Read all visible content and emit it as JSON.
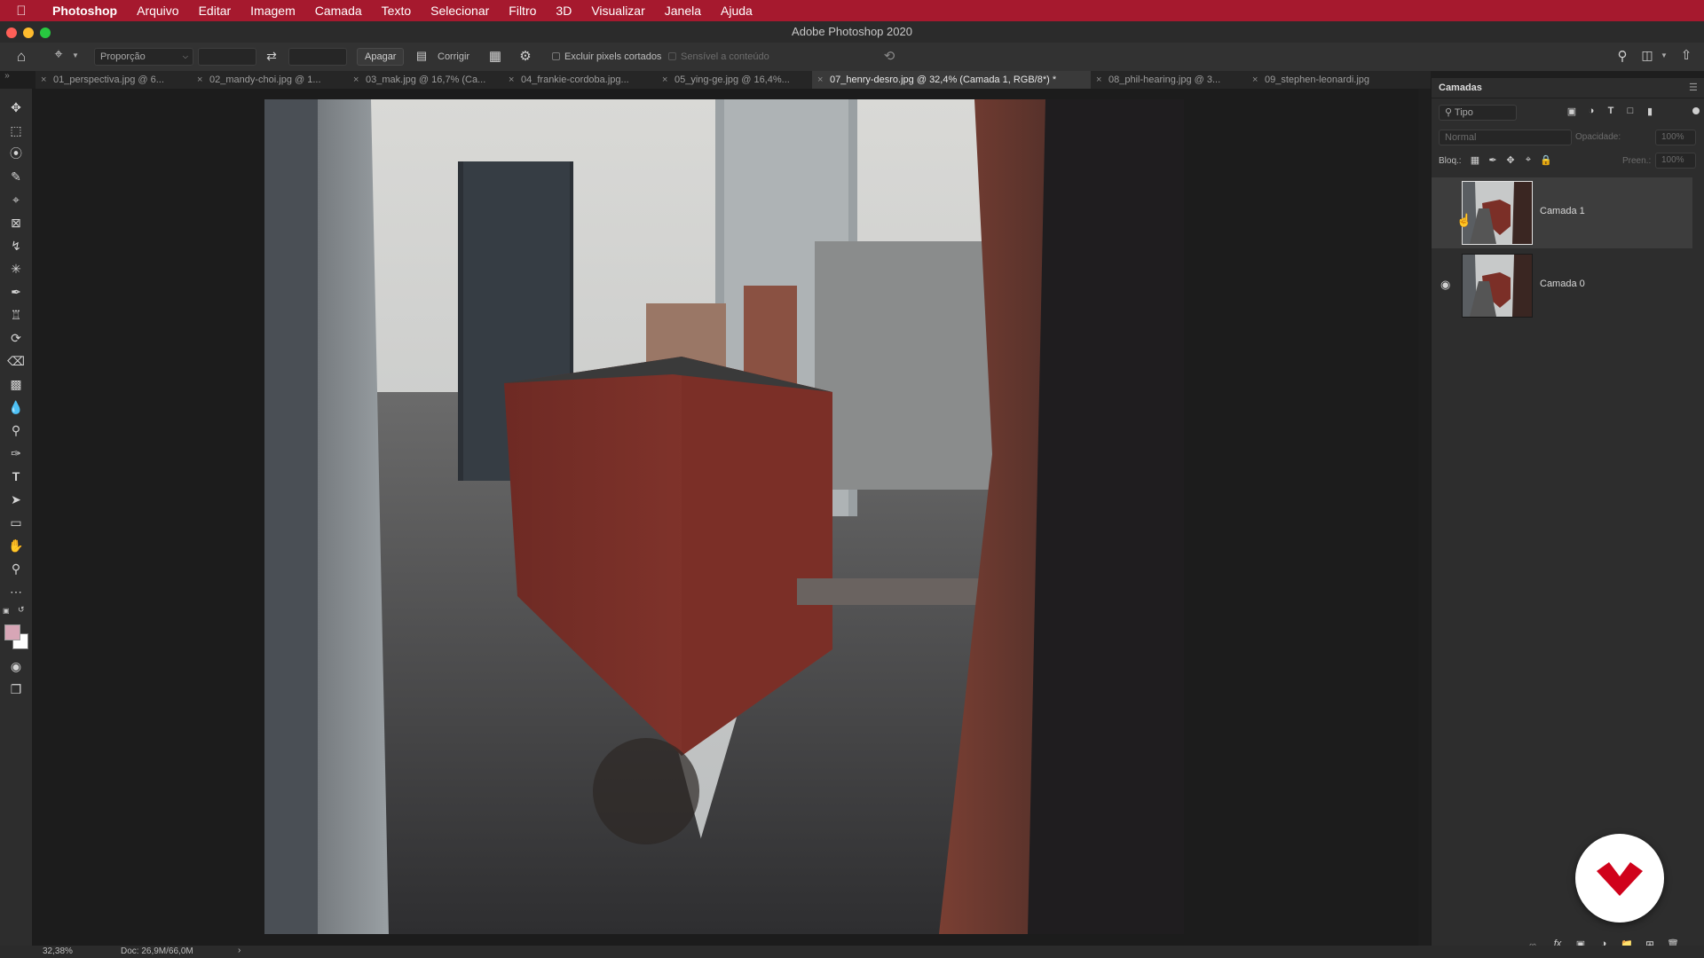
{
  "menubar": {
    "app_name": "Photoshop",
    "items": [
      "Arquivo",
      "Editar",
      "Imagem",
      "Camada",
      "Texto",
      "Selecionar",
      "Filtro",
      "3D",
      "Visualizar",
      "Janela",
      "Ajuda"
    ]
  },
  "window": {
    "title": "Adobe Photoshop 2020"
  },
  "options_bar": {
    "ratio_select": "Proporção",
    "delete_button": "Apagar",
    "straighten_label": "Corrigir",
    "delete_cropped_label": "Excluir pixels cortados",
    "content_aware_label": "Sensível a conteúdo"
  },
  "tabs": [
    {
      "label": "01_perspectiva.jpg @ 6...",
      "active": false
    },
    {
      "label": "02_mandy-choi.jpg @ 1...",
      "active": false
    },
    {
      "label": "03_mak.jpg @ 16,7% (Ca...",
      "active": false
    },
    {
      "label": "04_frankie-cordoba.jpg...",
      "active": false
    },
    {
      "label": "05_ying-ge.jpg @ 16,4%...",
      "active": false
    },
    {
      "label": "07_henry-desro.jpg @ 32,4% (Camada 1, RGB/8*) *",
      "active": true
    },
    {
      "label": "08_phil-hearing.jpg @ 3...",
      "active": false
    },
    {
      "label": "09_stephen-leonardi.jpg",
      "active": false
    }
  ],
  "layers_panel": {
    "title": "Camadas",
    "filter_kind": "Tipo",
    "blend_mode": "Normal",
    "opacity_label": "Opacidade:",
    "opacity_value": "100%",
    "lock_label": "Bloq.:",
    "fill_label": "Preen.:",
    "fill_value": "100%",
    "layers": [
      {
        "name": "Camada 1",
        "visible": false,
        "selected": true
      },
      {
        "name": "Camada 0",
        "visible": true,
        "selected": false
      }
    ]
  },
  "status": {
    "zoom": "32,38%",
    "doc": "Doc: 26,9M/66,0M"
  },
  "colors": {
    "menubar": "#a6192e",
    "foreground": "#d7a6b6",
    "background": "#ffffff",
    "accent_logo": "#d0021b"
  }
}
